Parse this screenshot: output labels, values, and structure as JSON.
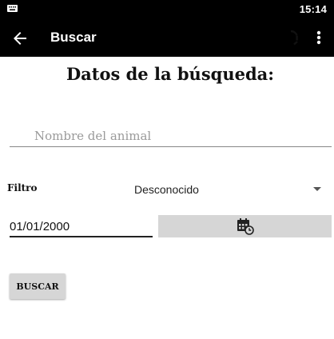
{
  "status_bar": {
    "time": "15:14",
    "keyboard_icon": "keyboard-icon"
  },
  "app_bar": {
    "title": "Buscar",
    "back_icon": "arrow-back-icon",
    "action_icon": "refresh-icon",
    "overflow_icon": "more-vert-icon"
  },
  "form": {
    "heading": "Datos de la búsqueda:",
    "name_placeholder": "Nombre del animal",
    "name_value": "",
    "filter_label": "Filtro",
    "filter_value": "Desconocido",
    "date_value": "01/01/2000",
    "calendar_icon": "calendar-clock-icon",
    "search_label": "BUSCAR"
  },
  "colors": {
    "app_bar_bg": "#000000",
    "button_bg": "#d6d6d6",
    "page_bg": "#ffffff"
  }
}
